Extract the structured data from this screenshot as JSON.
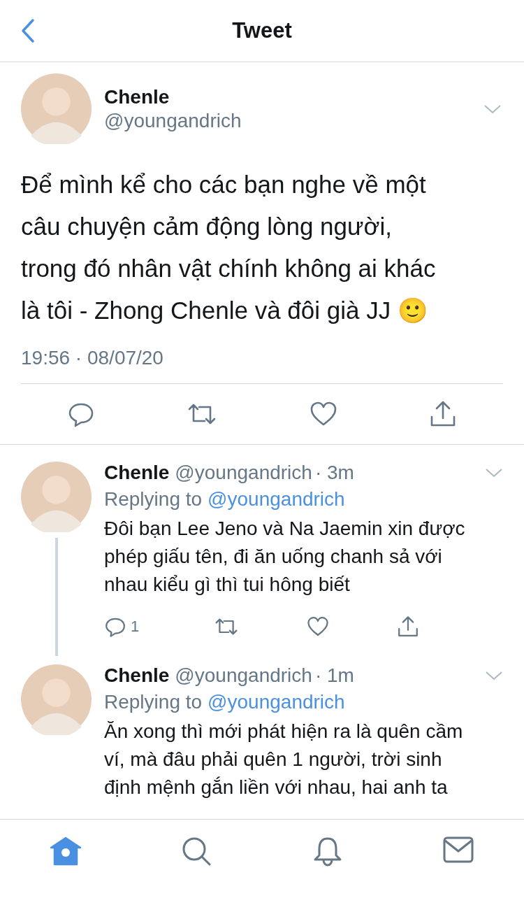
{
  "header": {
    "title": "Tweet"
  },
  "tweet": {
    "name": "Chenle",
    "handle": "@youngandrich",
    "body_lines": [
      "Để mình kể cho các bạn nghe về một",
      "câu chuyện cảm động lòng người,",
      "trong đó nhân vật chính không ai khác",
      "là tôi - Zhong Chenle và đôi già JJ 🙂"
    ],
    "timestamp": "19:56 · 08/07/20"
  },
  "replies": [
    {
      "name": "Chenle",
      "handle": "@youngandrich",
      "time": "· 3m",
      "replying_label": "Replying to",
      "replying_handle": "@youngandrich",
      "body_lines": [
        "Đôi bạn Lee Jeno và Na Jaemin xin được",
        "phép giấu tên, đi ăn uống chanh sả với",
        "nhau kiểu gì thì tui hông biết"
      ],
      "reply_count": "1"
    },
    {
      "name": "Chenle",
      "handle": "@youngandrich",
      "time": "· 1m",
      "replying_label": "Replying to",
      "replying_handle": "@youngandrich",
      "body_lines": [
        "Ăn xong thì mới phát hiện ra là quên cầm",
        "ví, mà đâu phải quên 1 người, trời sinh",
        "định mệnh gắn liền với nhau, hai anh ta"
      ]
    }
  ],
  "tab_bar": [
    {
      "kind": "home",
      "selected": true
    },
    {
      "kind": "search",
      "selected": false
    },
    {
      "kind": "notifications",
      "selected": false
    },
    {
      "kind": "messages",
      "selected": false
    }
  ]
}
